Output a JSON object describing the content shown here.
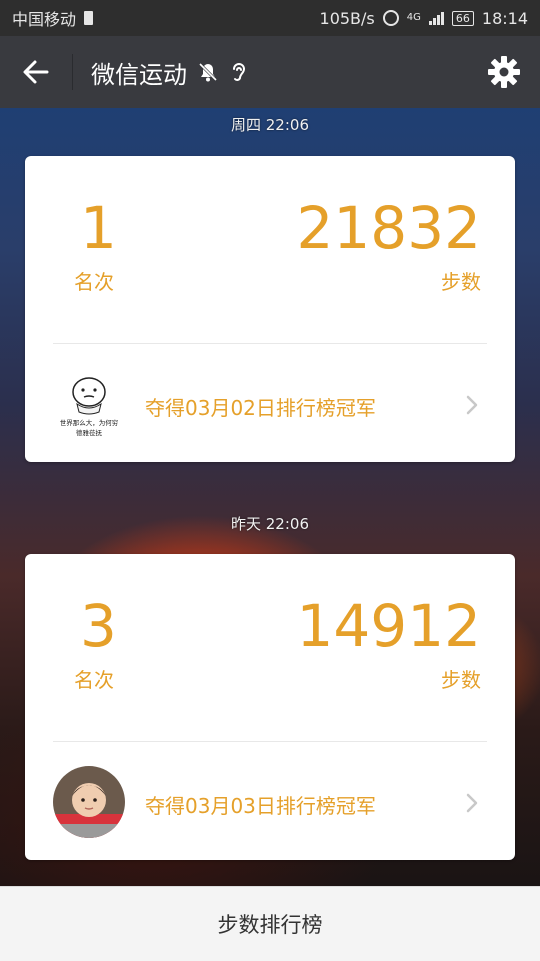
{
  "status_bar": {
    "carrier": "中国移动",
    "speed": "105B/s",
    "network": "4G",
    "battery": "66",
    "time": "18:14"
  },
  "app_bar": {
    "title": "微信运动",
    "back_icon": "arrow-left-icon",
    "mute_icon": "bell-off-icon",
    "ear_icon": "ear-icon",
    "settings_icon": "gear-icon"
  },
  "entries": [
    {
      "timestamp": "周四 22:06",
      "rank": "1",
      "rank_label": "名次",
      "steps": "21832",
      "steps_label": "步数",
      "champion_text": "夺得03月02日排行榜冠军",
      "meme_caption_line1": "世界那么大，为何穷",
      "meme_caption_line2": "德雅莅抚"
    },
    {
      "timestamp": "昨天 22:06",
      "rank": "3",
      "rank_label": "名次",
      "steps": "14912",
      "steps_label": "步数",
      "champion_text": "夺得03月03日排行榜冠军"
    }
  ],
  "bottom_bar": {
    "label": "步数排行榜"
  },
  "colors": {
    "accent": "#e5a02a",
    "appbar": "#393a3f",
    "statusbar": "#2e2e2e"
  }
}
